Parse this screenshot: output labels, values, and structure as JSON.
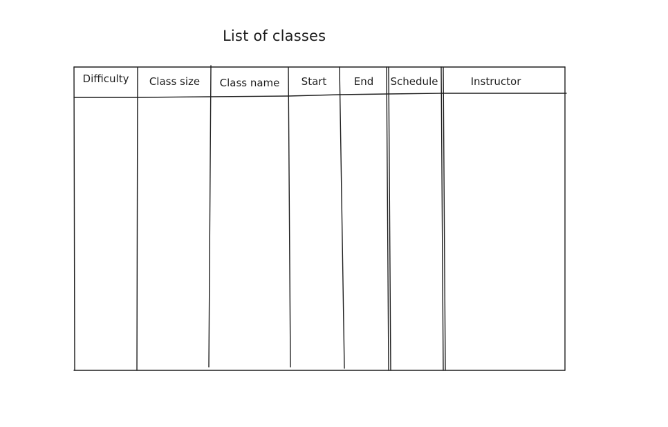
{
  "title": "List of classes",
  "table": {
    "columns": [
      {
        "label": "Difficulty"
      },
      {
        "label": "Class size"
      },
      {
        "label": "Class name"
      },
      {
        "label": "Start"
      },
      {
        "label": "End"
      },
      {
        "label": "Schedule"
      },
      {
        "label": "Instructor"
      }
    ],
    "rows": []
  },
  "colors": {
    "ink": "#1e1e1e",
    "background": "#ffffff"
  }
}
